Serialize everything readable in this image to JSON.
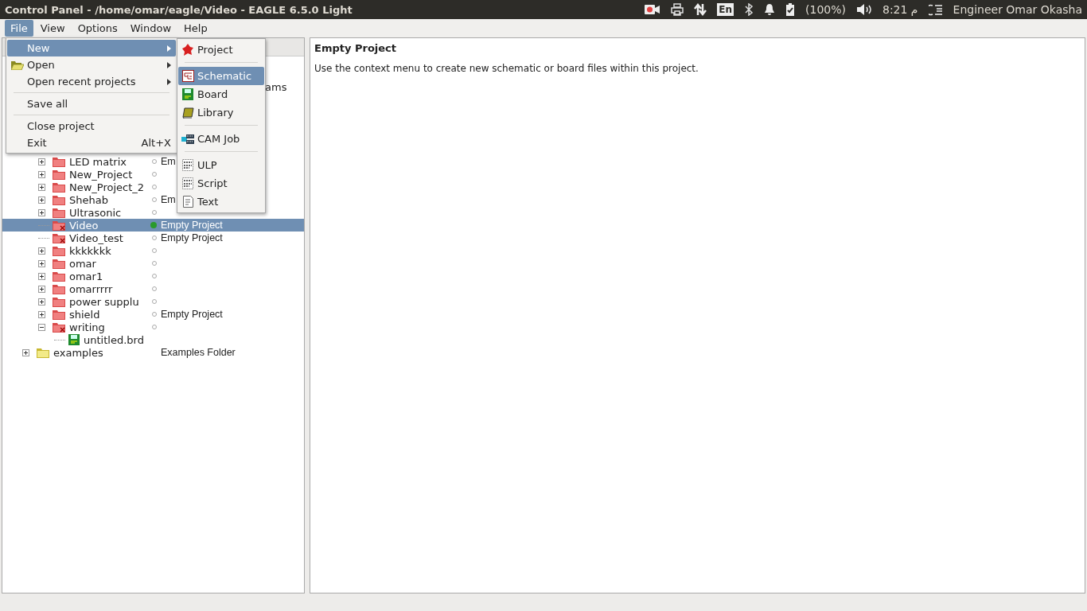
{
  "window": {
    "title": "Control Panel - /home/omar/eagle/Video - EAGLE 6.5.0 Light"
  },
  "top_panel": {
    "keyboard_layout": "En",
    "battery": "(100%)",
    "clock": "م 8:21",
    "user": "Engineer Omar Okasha"
  },
  "menubar": [
    {
      "label": "File",
      "selected": true
    },
    {
      "label": "View",
      "selected": false
    },
    {
      "label": "Options",
      "selected": false
    },
    {
      "label": "Window",
      "selected": false
    },
    {
      "label": "Help",
      "selected": false
    }
  ],
  "file_menu": [
    {
      "kind": "item",
      "label": "New",
      "submenu": true,
      "selected": true
    },
    {
      "kind": "item",
      "label": "Open",
      "submenu": true,
      "selected": false
    },
    {
      "kind": "item",
      "label": "Open recent projects",
      "submenu": true,
      "selected": false
    },
    {
      "kind": "separator"
    },
    {
      "kind": "item",
      "label": "Save all",
      "selected": false
    },
    {
      "kind": "separator"
    },
    {
      "kind": "item",
      "label": "Close project",
      "selected": false
    },
    {
      "kind": "item",
      "label": "Exit",
      "shortcut": "Alt+X",
      "selected": false
    }
  ],
  "new_submenu": [
    {
      "kind": "item",
      "label": "Project",
      "selected": false
    },
    {
      "kind": "separator"
    },
    {
      "kind": "item",
      "label": "Schematic",
      "selected": true
    },
    {
      "kind": "item",
      "label": "Board",
      "selected": false
    },
    {
      "kind": "item",
      "label": "Library",
      "selected": false
    },
    {
      "kind": "separator"
    },
    {
      "kind": "item",
      "label": "CAM Job",
      "selected": false
    },
    {
      "kind": "separator"
    },
    {
      "kind": "item",
      "label": "ULP",
      "selected": false
    },
    {
      "kind": "item",
      "label": "Script",
      "selected": false
    },
    {
      "kind": "item",
      "label": "Text",
      "selected": false
    }
  ],
  "tree": {
    "covered_fragment": "ams",
    "project_items": [
      {
        "kind": "project",
        "label": "LED matrix",
        "expanded": false,
        "open": false,
        "selected": false,
        "description": "Em"
      },
      {
        "kind": "project",
        "label": "New_Project",
        "expanded": false,
        "open": false,
        "selected": false
      },
      {
        "kind": "project",
        "label": "New_Project_2",
        "expanded": false,
        "open": false,
        "selected": false
      },
      {
        "kind": "project",
        "label": "Shehab",
        "expanded": false,
        "open": false,
        "selected": false,
        "description": "Em"
      },
      {
        "kind": "project",
        "label": "Ultrasonic",
        "expanded": false,
        "open": false,
        "selected": false
      },
      {
        "kind": "project_marked",
        "label": "Video",
        "open": true,
        "selected": true,
        "description": "Empty Project"
      },
      {
        "kind": "project_marked",
        "label": "Video_test",
        "open": false,
        "selected": false,
        "description": "Empty Project"
      },
      {
        "kind": "project",
        "label": "kkkkkkk",
        "expanded": false,
        "open": false,
        "selected": false
      },
      {
        "kind": "project",
        "label": "omar",
        "expanded": false,
        "open": false,
        "selected": false
      },
      {
        "kind": "project",
        "label": "omar1",
        "expanded": false,
        "open": false,
        "selected": false
      },
      {
        "kind": "project",
        "label": "omarrrrr",
        "expanded": false,
        "open": false,
        "selected": false
      },
      {
        "kind": "project",
        "label": "power supplu",
        "expanded": false,
        "open": false,
        "selected": false
      },
      {
        "kind": "project",
        "label": "shield",
        "expanded": false,
        "open": false,
        "selected": false,
        "description": "Empty Project"
      },
      {
        "kind": "project_marked",
        "label": "writing",
        "expanded": true,
        "open": false,
        "selected": false,
        "children": [
          {
            "kind": "board",
            "label": "untitled.brd",
            "selected": false
          }
        ]
      }
    ],
    "top_items": [
      {
        "kind": "folder",
        "label": "examples",
        "expanded": false,
        "selected": false,
        "description": "Examples Folder"
      }
    ]
  },
  "detail": {
    "title": "Empty Project",
    "text": "Use the context menu to create new schematic or board files within this project."
  }
}
